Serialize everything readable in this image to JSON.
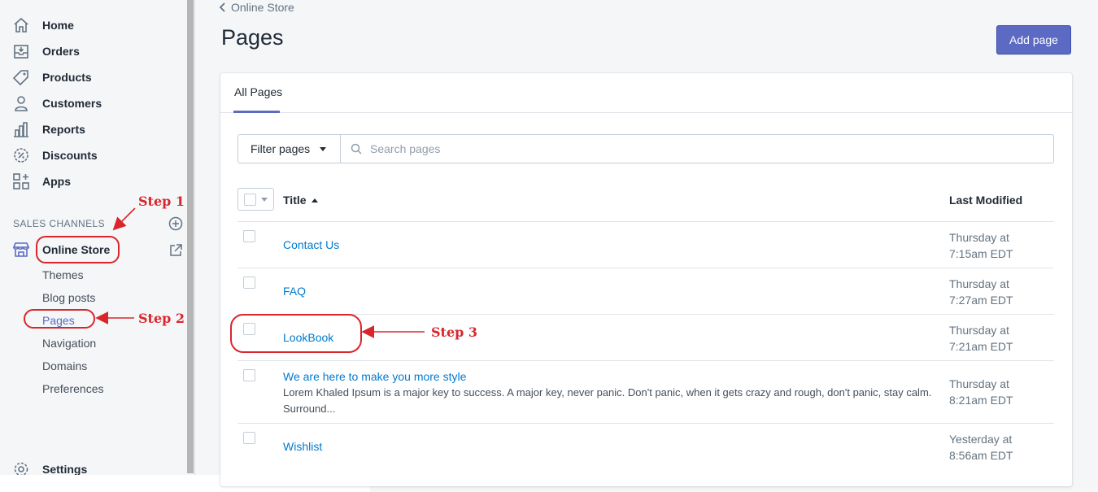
{
  "sidebar": {
    "nav": [
      {
        "label": "Home",
        "icon": "home-icon"
      },
      {
        "label": "Orders",
        "icon": "orders-icon"
      },
      {
        "label": "Products",
        "icon": "tag-icon"
      },
      {
        "label": "Customers",
        "icon": "person-icon"
      },
      {
        "label": "Reports",
        "icon": "bar-chart-icon"
      },
      {
        "label": "Discounts",
        "icon": "discount-icon"
      },
      {
        "label": "Apps",
        "icon": "apps-icon"
      }
    ],
    "sales_channels_title": "SALES CHANNELS",
    "online_store": "Online Store",
    "sub_items": [
      "Themes",
      "Blog posts",
      "Pages",
      "Navigation",
      "Domains",
      "Preferences"
    ],
    "active_sub_item": "Pages",
    "settings": "Settings"
  },
  "header": {
    "breadcrumb": "Online Store",
    "title": "Pages",
    "add_button": "Add page"
  },
  "tabs": [
    {
      "label": "All Pages",
      "active": true
    }
  ],
  "filters": {
    "filter_label": "Filter pages",
    "search_placeholder": "Search pages"
  },
  "table": {
    "columns": {
      "title": "Title",
      "modified": "Last Modified"
    },
    "rows": [
      {
        "title": "Contact Us",
        "excerpt": "",
        "modified_line1": "Thursday at",
        "modified_line2": "7:15am EDT"
      },
      {
        "title": "FAQ",
        "excerpt": "",
        "modified_line1": "Thursday at",
        "modified_line2": "7:27am EDT"
      },
      {
        "title": "LookBook",
        "excerpt": "",
        "modified_line1": "Thursday at",
        "modified_line2": "7:21am EDT"
      },
      {
        "title": "We are here to make you more style",
        "excerpt": "Lorem Khaled Ipsum is a major key to success. A major key, never panic. Don't panic, when it gets crazy and rough, don't panic, stay calm. Surround...",
        "modified_line1": "Thursday at",
        "modified_line2": "8:21am EDT"
      },
      {
        "title": "Wishlist",
        "excerpt": "",
        "modified_line1": "Yesterday at",
        "modified_line2": "8:56am EDT"
      }
    ]
  },
  "annotations": {
    "step1": "Step 1",
    "step2": "Step 2",
    "step3": "Step 3"
  },
  "colors": {
    "accent": "#5c6ac4",
    "link": "#007ace",
    "annotation": "#d9262c"
  }
}
